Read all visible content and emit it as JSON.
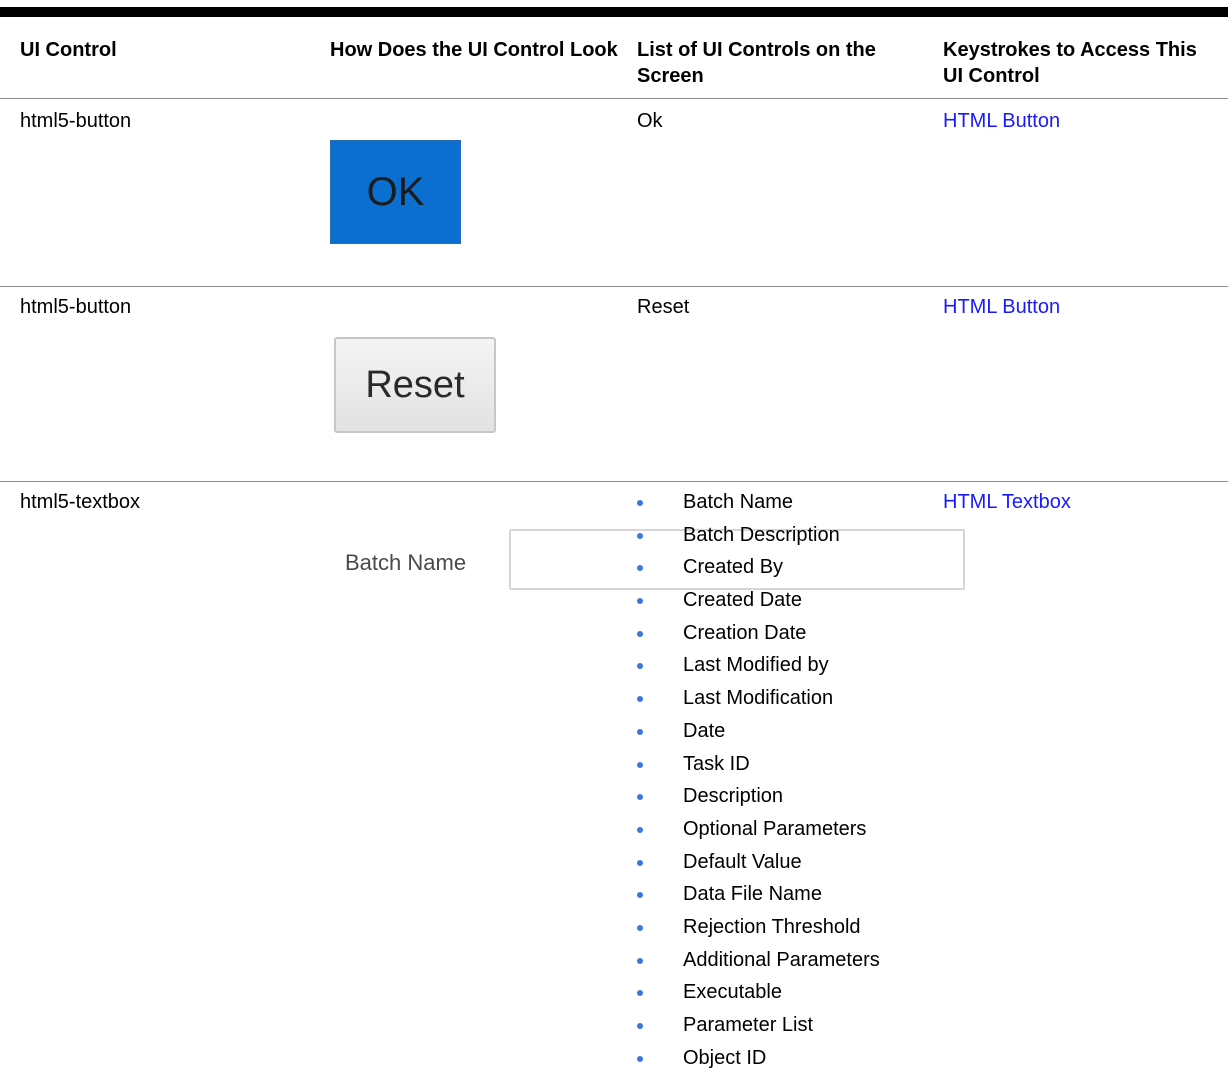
{
  "headers": {
    "col1": "UI Control",
    "col2": "How Does the UI Control Look",
    "col3": "List of UI Controls on the Screen",
    "col4": "Keystrokes to Access This UI Control"
  },
  "rows": [
    {
      "control": "html5-button",
      "look_text": "OK",
      "list": "Ok",
      "keystrokes": "HTML Button"
    },
    {
      "control": "html5-button",
      "look_text": "Reset",
      "list": "Reset",
      "keystrokes": "HTML Button"
    },
    {
      "control": "html5-textbox",
      "look_label": "Batch Name",
      "list_items": [
        "Batch Name",
        "Batch Description",
        "Created By",
        "Created Date",
        "Creation Date",
        "Last Modified by",
        "Last Modification",
        "Date",
        "Task ID",
        "Description",
        "Optional Parameters",
        "Default Value",
        "Data File Name",
        "Rejection Threshold",
        "Additional Parameters",
        "Executable",
        "Parameter List",
        "Object ID"
      ],
      "keystrokes": "HTML Textbox"
    }
  ],
  "colors": {
    "link": "#1a1aff",
    "ok_button_bg": "#0b6fd0",
    "bullet": "#3d78d8"
  }
}
